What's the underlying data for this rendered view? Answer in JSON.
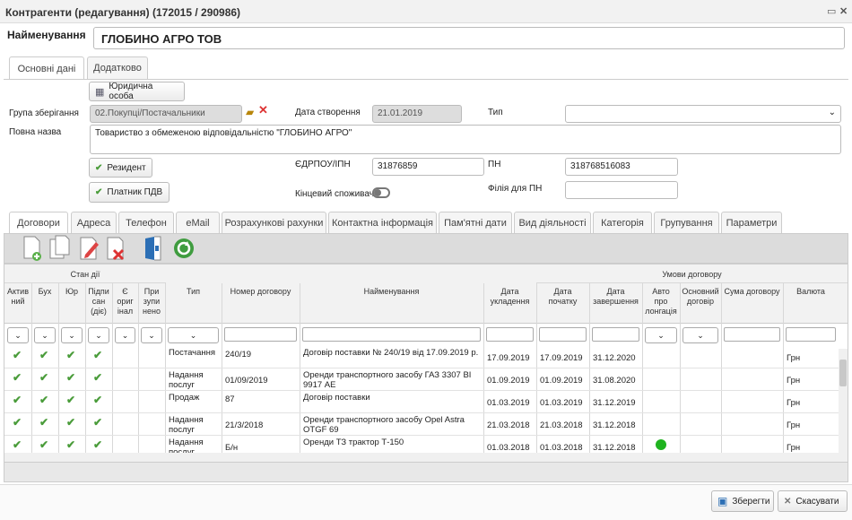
{
  "window": {
    "title": "Контрагенти (редагування) (172015 / 290986)"
  },
  "header": {
    "name_label": "Найменування",
    "name_value": "ГЛОБИНО АГРО ТОВ"
  },
  "top_tabs": [
    {
      "label": "Основні дані"
    },
    {
      "label": "Додатково"
    }
  ],
  "form": {
    "legal_button": "Юридична особа",
    "group_label": "Група зберігання",
    "group_value": "02.Покупці/Постачальники",
    "created_label": "Дата створення",
    "created_value": "21.01.2019",
    "type_label": "Тип",
    "type_value": "",
    "fullname_label": "Повна назва",
    "fullname_value": "Товариство з обмеженою відповідальністю \"ГЛОБИНО АГРО\"",
    "resident_button": "Резидент",
    "edrpou_label": "ЄДРПОУ/ІПН",
    "edrpou_value": "31876859",
    "pn_label": "ПН",
    "pn_value": "318768516083",
    "vat_button": "Платник ПДВ",
    "consumer_label": "Кінцевий споживач",
    "branch_label": "Філія для ПН",
    "branch_value": ""
  },
  "sub_tabs": [
    {
      "label": "Договори"
    },
    {
      "label": "Адреса"
    },
    {
      "label": "Телефон"
    },
    {
      "label": "eMail"
    },
    {
      "label": "Розрахункові рахунки"
    },
    {
      "label": "Контактна інформація"
    },
    {
      "label": "Пам'ятні дати"
    },
    {
      "label": "Вид діяльності"
    },
    {
      "label": "Категорія"
    },
    {
      "label": "Групування"
    },
    {
      "label": "Параметри"
    }
  ],
  "grid": {
    "group_state": "Стан дії",
    "group_terms": "Умови договору",
    "columns": [
      {
        "l1": "Актив",
        "l2": "ний",
        "l3": ""
      },
      {
        "l1": "Бух",
        "l2": "",
        "l3": ""
      },
      {
        "l1": "Юр",
        "l2": "",
        "l3": ""
      },
      {
        "l1": "Підпи",
        "l2": "сан",
        "l3": "(діє)"
      },
      {
        "l1": "Є",
        "l2": "ориг",
        "l3": "інал"
      },
      {
        "l1": "При",
        "l2": "зупи",
        "l3": "нено"
      },
      {
        "l1": "Тип",
        "l2": "",
        "l3": ""
      },
      {
        "l1": "Номер договору",
        "l2": "",
        "l3": ""
      },
      {
        "l1": "Найменування",
        "l2": "",
        "l3": ""
      },
      {
        "l1": "Дата",
        "l2": "укладення",
        "l3": ""
      },
      {
        "l1": "Дата",
        "l2": "початку",
        "l3": ""
      },
      {
        "l1": "Дата",
        "l2": "завершення",
        "l3": ""
      },
      {
        "l1": "Авто",
        "l2": "про",
        "l3": "лонгація"
      },
      {
        "l1": "Основний",
        "l2": "договір",
        "l3": ""
      },
      {
        "l1": "Сума договору",
        "l2": "",
        "l3": ""
      },
      {
        "l1": "Валюта",
        "l2": "",
        "l3": ""
      }
    ],
    "check_mark": "✔",
    "rows": [
      {
        "checks": 4,
        "type1": "Постачання",
        "type2": "",
        "num": "240/19",
        "name1": "Договір поставки № 240/19 від 17.09.2019 р.",
        "name2": "",
        "d1": "17.09.2019",
        "d2": "17.09.2019",
        "d3": "31.12.2020",
        "auto": false,
        "cur": "Грн"
      },
      {
        "checks": 4,
        "type1": "Надання",
        "type2": "послуг",
        "num": "01/09/2019",
        "name1": "Оренди транспортного засобу ГАЗ 3307 ВІ",
        "name2": "9917 АЕ",
        "d1": "01.09.2019",
        "d2": "01.09.2019",
        "d3": "31.08.2020",
        "auto": false,
        "cur": "Грн"
      },
      {
        "checks": 4,
        "type1": "Продаж",
        "type2": "",
        "num": "87",
        "name1": "Договір поставки",
        "name2": "",
        "d1": "01.03.2019",
        "d2": "01.03.2019",
        "d3": "31.12.2019",
        "auto": false,
        "cur": "Грн"
      },
      {
        "checks": 4,
        "type1": "Надання",
        "type2": "послуг",
        "num": "21/3/2018",
        "name1": "Оренди транспортного засобу Opel Astra",
        "name2": "OTGF 69",
        "d1": "21.03.2018",
        "d2": "21.03.2018",
        "d3": "31.12.2018",
        "auto": false,
        "cur": "Грн"
      },
      {
        "checks": 4,
        "type1": "Надання",
        "type2": "послуг",
        "num": "Б/н",
        "name1": "Оренди ТЗ трактор Т-150",
        "name2": "",
        "d1": "01.03.2018",
        "d2": "01.03.2018",
        "d3": "31.12.2018",
        "auto": true,
        "cur": "Грн"
      }
    ]
  },
  "footer": {
    "save": "Зберегти",
    "cancel": "Скасувати"
  },
  "colors": {
    "accent_green": "#4a9c3a",
    "dot_green": "#1fb31f",
    "delete_red": "#d33"
  }
}
